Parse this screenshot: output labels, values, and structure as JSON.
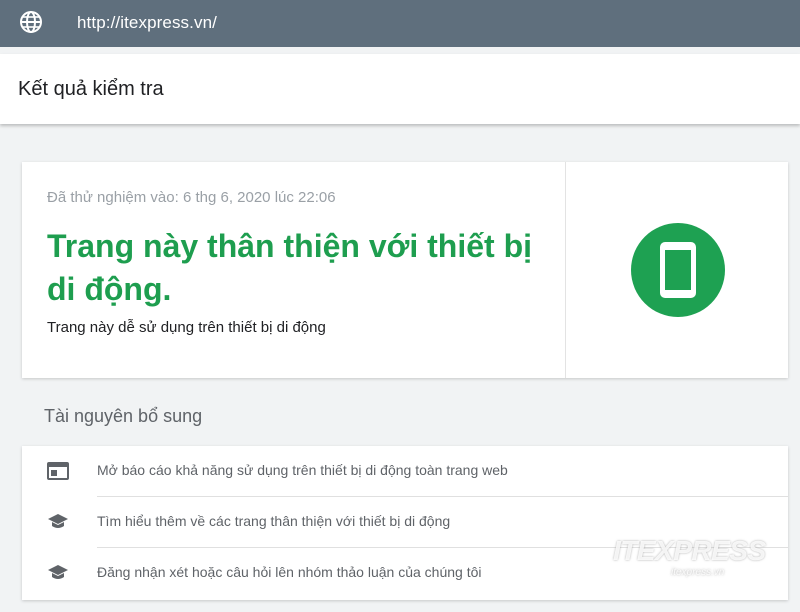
{
  "address_bar": {
    "url": "http://itexpress.vn/",
    "icon": "globe-icon"
  },
  "header": {
    "title": "Kết quả kiểm tra"
  },
  "result": {
    "tested_at": "Đã thử nghiệm vào: 6 thg 6, 2020 lúc 22:06",
    "headline": "Trang này thân thiện với thiết bị di động.",
    "subtext": "Trang này dễ sử dụng trên thiết bị di động",
    "status_icon": "mobile-phone-icon",
    "status_color": "#1ea152"
  },
  "resources": {
    "title": "Tài nguyên bổ sung",
    "items": [
      {
        "icon": "report-window-icon",
        "label": "Mở báo cáo khả năng sử dụng trên thiết bị di động toàn trang web"
      },
      {
        "icon": "graduation-cap-icon",
        "label": "Tìm hiểu thêm về các trang thân thiện với thiết bị di động"
      },
      {
        "icon": "graduation-cap-icon",
        "label": "Đăng nhận xét hoặc câu hỏi lên nhóm thảo luận của chúng tôi"
      }
    ]
  },
  "watermark": {
    "brand": "ITEXPRESS",
    "domain": "itexpress.vn"
  },
  "colors": {
    "topbar": "#5f6f7d",
    "accent_green": "#1e9e4f",
    "background": "#f1f3f4"
  }
}
